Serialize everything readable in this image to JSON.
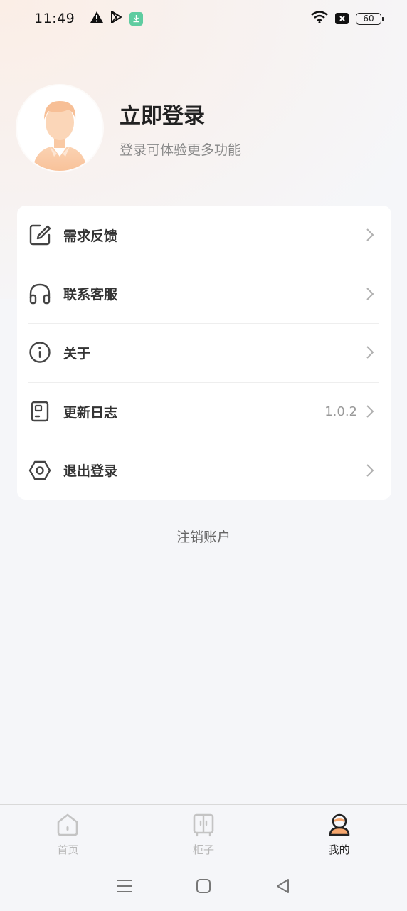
{
  "status_bar": {
    "time": "11:49",
    "battery": "60",
    "icons": [
      "warning-icon",
      "play-store-icon",
      "download-icon",
      "wifi-icon",
      "no-sim-icon",
      "battery-icon"
    ]
  },
  "profile": {
    "title": "立即登录",
    "subtitle": "登录可体验更多功能"
  },
  "menu": {
    "items": [
      {
        "label": "需求反馈",
        "icon": "edit-icon"
      },
      {
        "label": "联系客服",
        "icon": "headphones-icon"
      },
      {
        "label": "关于",
        "icon": "info-icon"
      },
      {
        "label": "更新日志",
        "icon": "log-icon",
        "value": "1.0.2"
      },
      {
        "label": "退出登录",
        "icon": "logout-hexagon-icon"
      }
    ]
  },
  "cancel_account": "注销账户",
  "tabbar": {
    "tabs": [
      {
        "label": "首页",
        "icon": "home-icon",
        "active": false
      },
      {
        "label": "柜子",
        "icon": "cabinet-icon",
        "active": false
      },
      {
        "label": "我的",
        "icon": "profile-icon",
        "active": true
      }
    ]
  },
  "colors": {
    "accent": "#f5a66d",
    "background": "#f5f6f9",
    "card": "#ffffff",
    "text_primary": "#333333",
    "text_secondary": "#8a8a8a"
  }
}
